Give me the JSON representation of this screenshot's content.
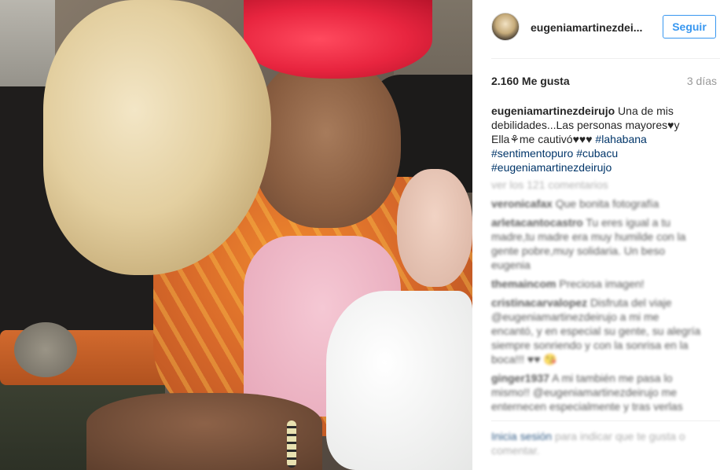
{
  "post": {
    "username": "eugeniamartinezdei...",
    "follow_label": "Seguir",
    "likes": "2.160 Me gusta",
    "time_ago": "3 días",
    "caption": {
      "user": "eugeniamartinezdeirujo",
      "text": "Una de mis debilidades...Las personas mayores♥y Ella⚘me cautivó♥♥♥",
      "tags": [
        "#lahabana",
        "#sentimentopuro",
        "#cubacu",
        "#eugeniamartinezdeirujo"
      ]
    },
    "view_all": "ver los 121 comentarios",
    "comments": [
      {
        "user": "veronicafax",
        "text": "Que bonita fotografía"
      },
      {
        "user": "arletacantocastro",
        "text": "Tu eres igual a tu madre,tu madre era muy humilde con la gente pobre,muy solidaria. Un beso eugenia"
      },
      {
        "user": "themaincom",
        "text": "Preciosa imagen!"
      },
      {
        "user": "cristinacarvalopez",
        "text": "Disfruta del viaje @eugeniamartinezdeirujo a mi me encantó, y en especial su gente, su alegría siempre sonriendo y con la sonrisa en la boca!!! ♥♥ 😘"
      },
      {
        "user": "ginger1937",
        "text": "A mi también me pasa lo mismo!! @eugeniamartinezdeirujo me enternecen especialmente y tras verlas"
      }
    ],
    "footer": {
      "login": "Inicia sesión",
      "rest": "para indicar que te gusta o comentar."
    }
  }
}
